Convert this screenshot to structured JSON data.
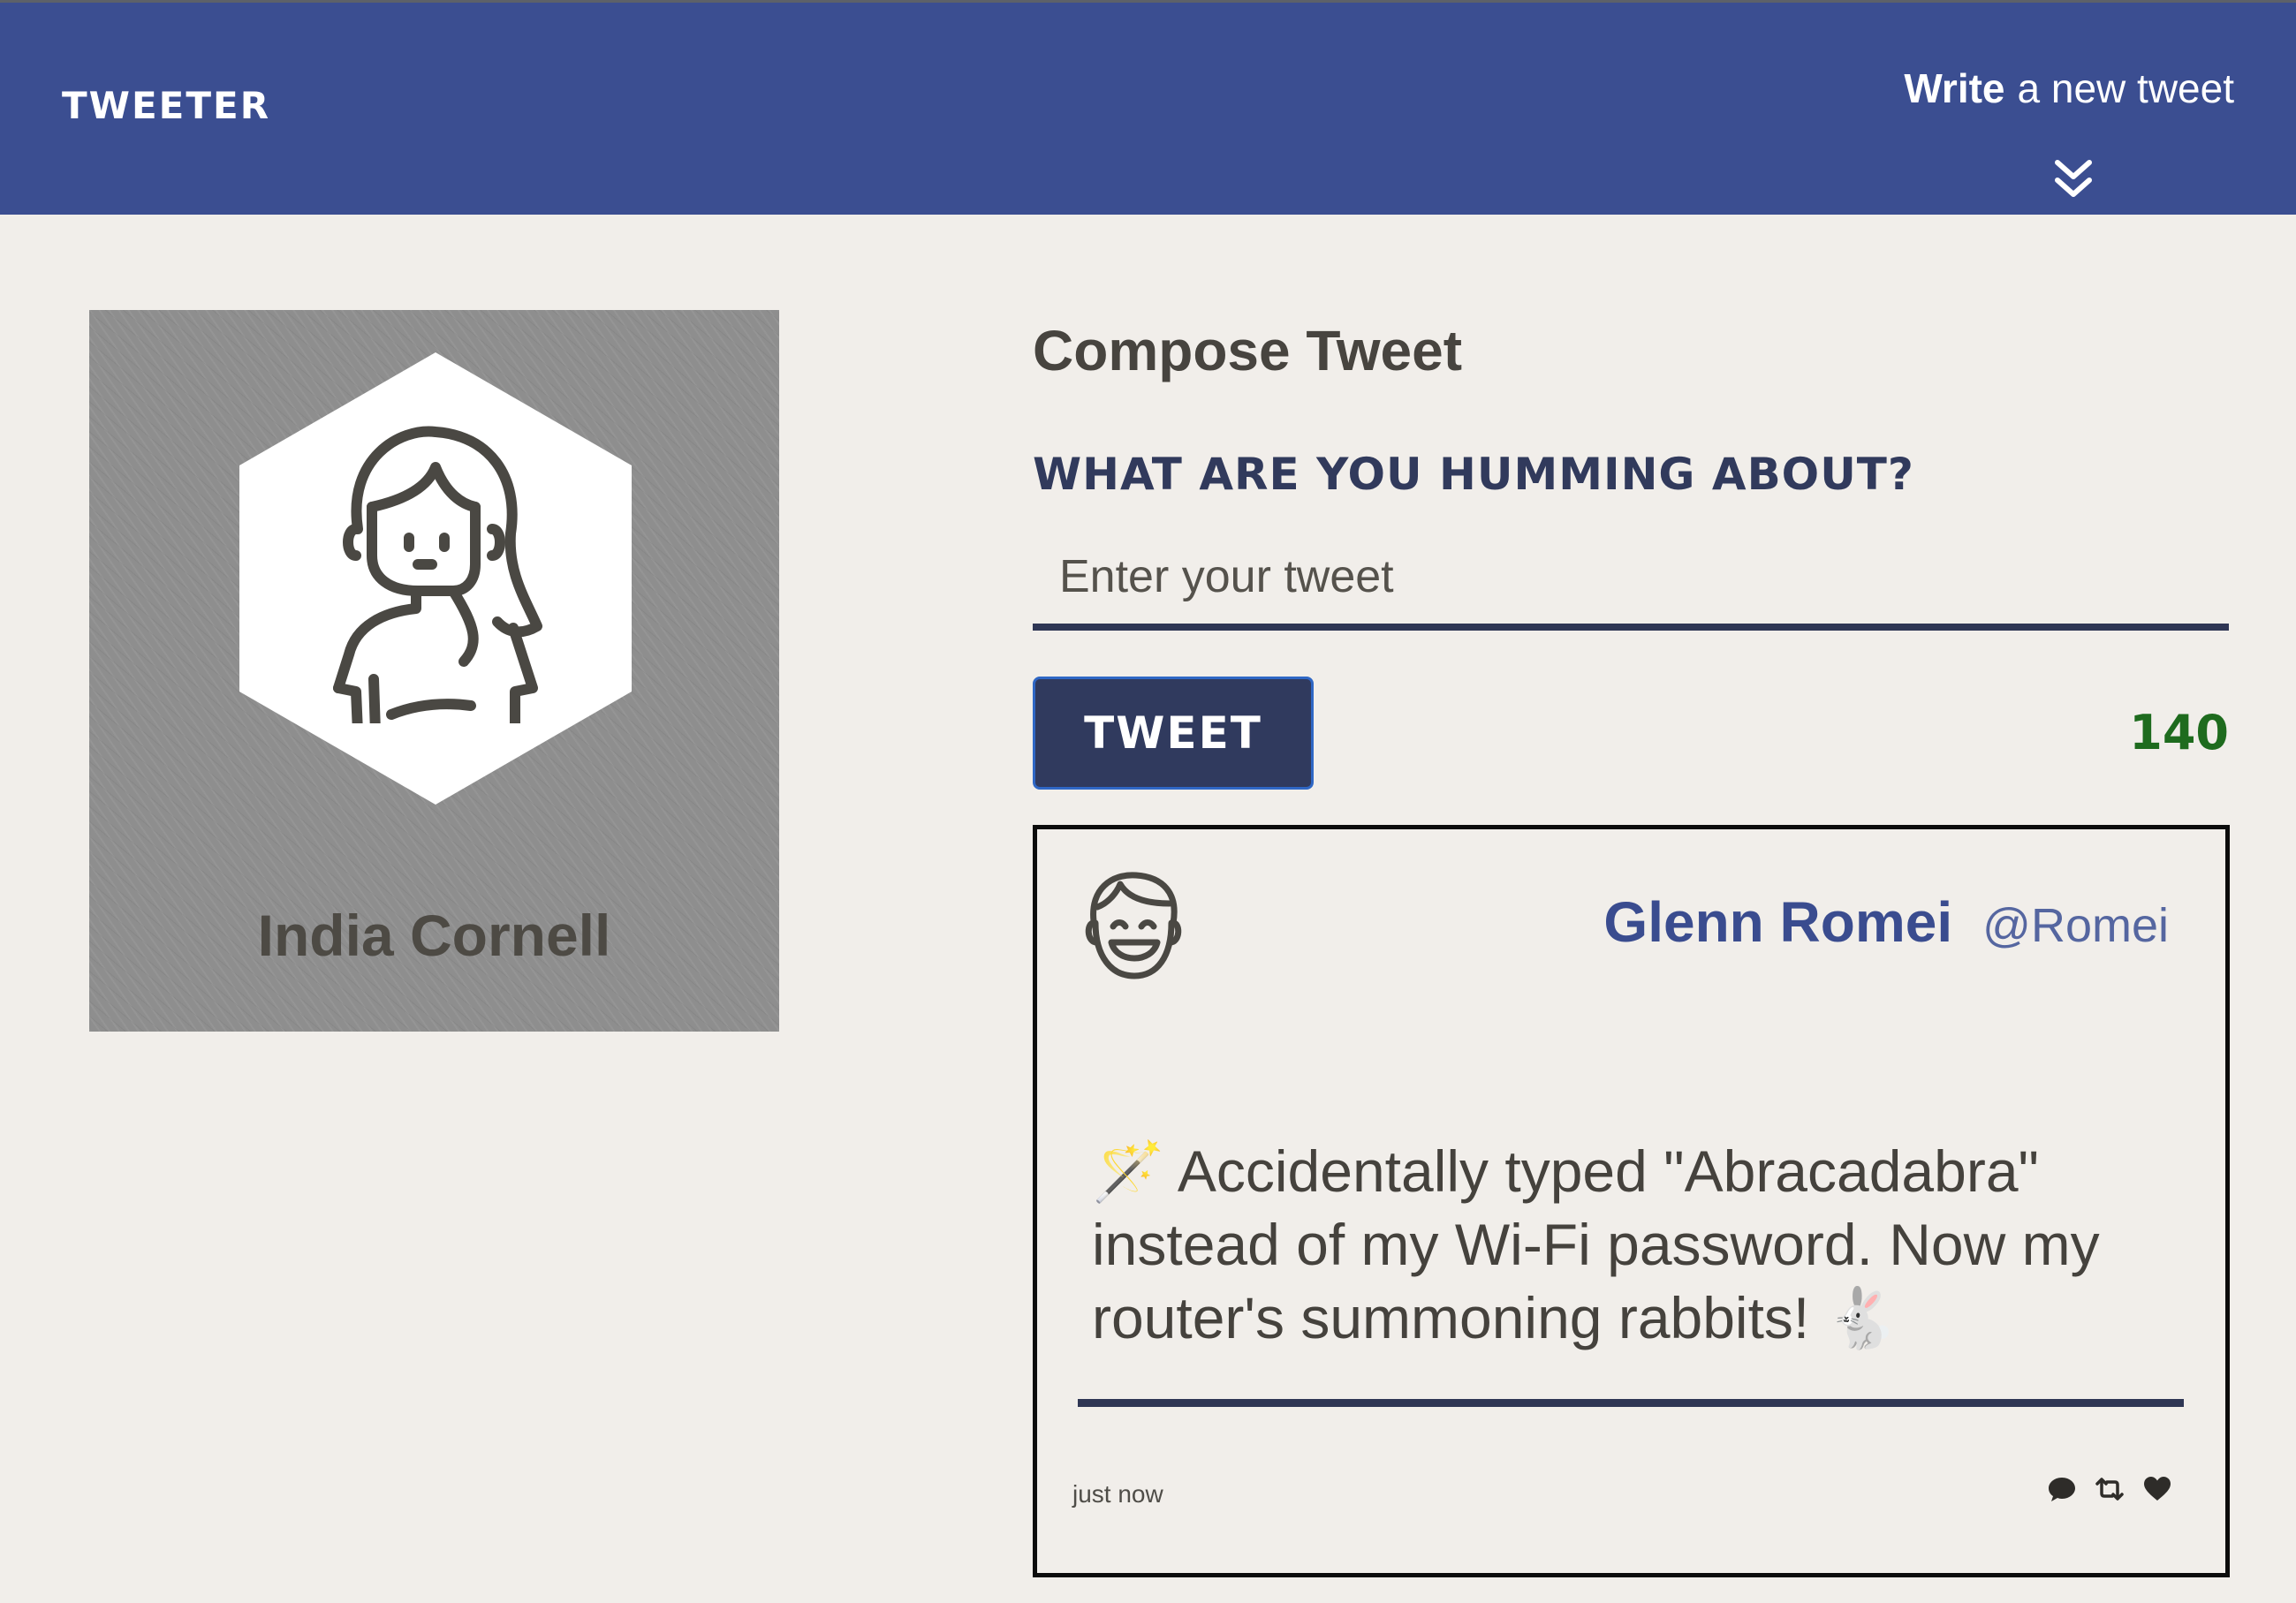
{
  "nav": {
    "brand": "TWEETER",
    "compose_toggle_strong": "Write",
    "compose_toggle_rest": "a new tweet",
    "chevron_icon": "double-chevron-down"
  },
  "profile": {
    "name": "India Cornell",
    "avatar_icon": "woman-long-hair-avatar"
  },
  "compose": {
    "heading": "Compose Tweet",
    "label": "WHAT ARE YOU HUMMING ABOUT?",
    "placeholder": "Enter your tweet",
    "value": "",
    "button_label": "TWEET",
    "char_count": "140"
  },
  "tweets": [
    {
      "author": "Glenn Romei",
      "handle": "@Romei",
      "avatar_icon": "smiling-man-avatar",
      "text": "🪄 Accidentally typed \"Abracadabra\" instead of my Wi-Fi password. Now my router's summoning rabbits! 🐇",
      "time": "just now",
      "actions": [
        "comment-icon",
        "retweet-icon",
        "heart-icon"
      ]
    }
  ],
  "colors": {
    "nav_bg": "#3b4e91",
    "page_bg": "#f1eeea",
    "accent_dark": "#303a5e",
    "counter": "#1e6b1e",
    "author": "#3a4c8f"
  }
}
